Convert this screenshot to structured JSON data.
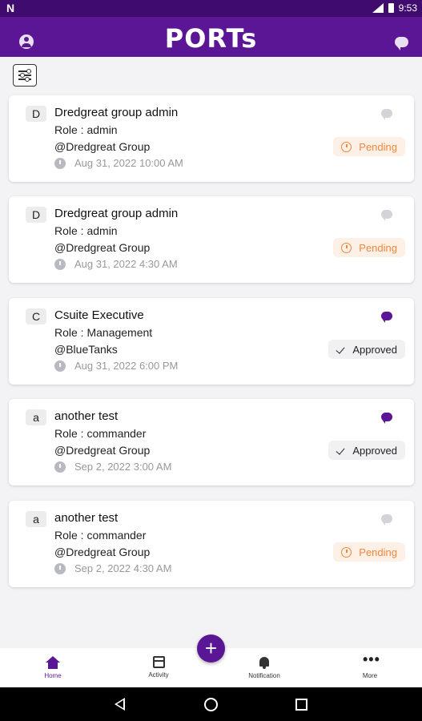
{
  "status_bar": {
    "carrier_icon": "N",
    "time": "9:53"
  },
  "app_bar": {
    "logo": "PORTs",
    "profile_icon": "profile-icon",
    "chat_icon": "chat-icon"
  },
  "filter_button": {
    "icon": "sliders-icon"
  },
  "colors": {
    "primary": "#5b1695",
    "status_bar": "#3f0b6e",
    "pending": "#f0873a",
    "pending_bg": "#fdf0e6"
  },
  "cards": [
    {
      "avatar": "D",
      "name": "Dredgreat group admin",
      "role": "Role : admin",
      "group": "@Dredgreat Group",
      "date": "Aug 31, 2022 10:00 AM",
      "status": "Pending",
      "chat_state": "grey"
    },
    {
      "avatar": "D",
      "name": "Dredgreat group admin",
      "role": "Role : admin",
      "group": "@Dredgreat Group",
      "date": "Aug 31, 2022 4:30 AM",
      "status": "Pending",
      "chat_state": "grey"
    },
    {
      "avatar": "C",
      "name": "Csuite Executive",
      "role": "Role : Management",
      "group": "@BlueTanks",
      "date": "Aug 31, 2022 6:00 PM",
      "status": "Approved",
      "chat_state": "purple"
    },
    {
      "avatar": "a",
      "name": "another test",
      "role": "Role : commander",
      "group": "@Dredgreat Group",
      "date": "Sep 2, 2022 3:00 AM",
      "status": "Approved",
      "chat_state": "purple"
    },
    {
      "avatar": "a",
      "name": "another test",
      "role": "Role : commander",
      "group": "@Dredgreat Group",
      "date": "Sep 2, 2022 4:30 AM",
      "status": "Pending",
      "chat_state": "grey"
    }
  ],
  "fab": {
    "label": "+"
  },
  "bottom_nav": [
    {
      "label": "Home",
      "icon": "home-icon",
      "active": true
    },
    {
      "label": "Activity",
      "icon": "calendar-icon",
      "active": false
    },
    {
      "label": "Notification",
      "icon": "bell-icon",
      "active": false
    },
    {
      "label": "More",
      "icon": "more-icon",
      "active": false
    }
  ]
}
